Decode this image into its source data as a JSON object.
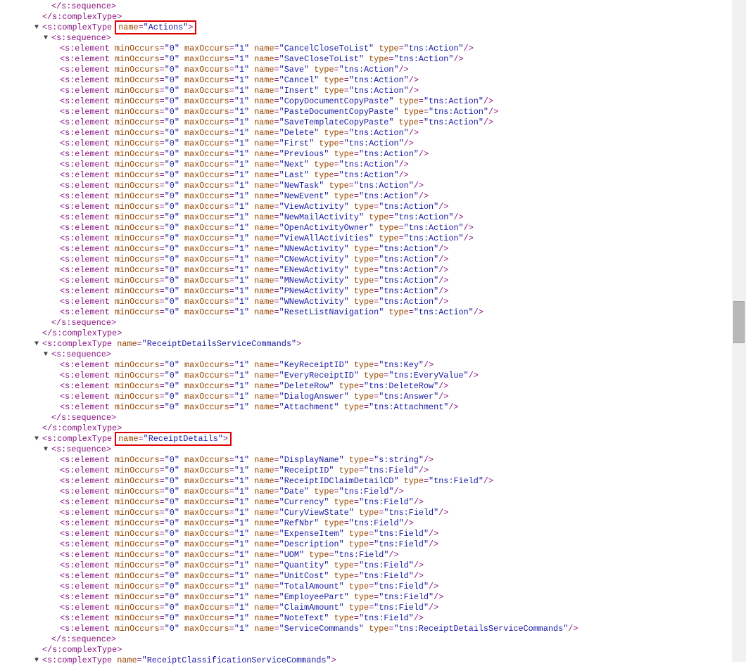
{
  "colors": {
    "tag": "#881280",
    "attr_name": "#994500",
    "attr_value": "#1a1aa6",
    "highlight": "#e00000"
  },
  "lines": [
    {
      "kind": "close",
      "tag": "s:sequence",
      "level": 1
    },
    {
      "kind": "close",
      "tag": "s:complexType",
      "level": 0
    },
    {
      "kind": "open",
      "tag": "s:complexType",
      "name": "Actions",
      "level": 0,
      "highlight": true
    },
    {
      "kind": "open",
      "tag": "s:sequence",
      "level": 1
    },
    {
      "kind": "el",
      "name": "CancelCloseToList",
      "type": "tns:Action"
    },
    {
      "kind": "el",
      "name": "SaveCloseToList",
      "type": "tns:Action"
    },
    {
      "kind": "el",
      "name": "Save",
      "type": "tns:Action"
    },
    {
      "kind": "el",
      "name": "Cancel",
      "type": "tns:Action"
    },
    {
      "kind": "el",
      "name": "Insert",
      "type": "tns:Action"
    },
    {
      "kind": "el",
      "name": "CopyDocumentCopyPaste",
      "type": "tns:Action"
    },
    {
      "kind": "el",
      "name": "PasteDocumentCopyPaste",
      "type": "tns:Action"
    },
    {
      "kind": "el",
      "name": "SaveTemplateCopyPaste",
      "type": "tns:Action"
    },
    {
      "kind": "el",
      "name": "Delete",
      "type": "tns:Action"
    },
    {
      "kind": "el",
      "name": "First",
      "type": "tns:Action"
    },
    {
      "kind": "el",
      "name": "Previous",
      "type": "tns:Action"
    },
    {
      "kind": "el",
      "name": "Next",
      "type": "tns:Action"
    },
    {
      "kind": "el",
      "name": "Last",
      "type": "tns:Action"
    },
    {
      "kind": "el",
      "name": "NewTask",
      "type": "tns:Action"
    },
    {
      "kind": "el",
      "name": "NewEvent",
      "type": "tns:Action"
    },
    {
      "kind": "el",
      "name": "ViewActivity",
      "type": "tns:Action"
    },
    {
      "kind": "el",
      "name": "NewMailActivity",
      "type": "tns:Action"
    },
    {
      "kind": "el",
      "name": "OpenActivityOwner",
      "type": "tns:Action"
    },
    {
      "kind": "el",
      "name": "ViewAllActivities",
      "type": "tns:Action"
    },
    {
      "kind": "el",
      "name": "NNewActivity",
      "type": "tns:Action"
    },
    {
      "kind": "el",
      "name": "CNewActivity",
      "type": "tns:Action"
    },
    {
      "kind": "el",
      "name": "ENewActivity",
      "type": "tns:Action"
    },
    {
      "kind": "el",
      "name": "MNewActivity",
      "type": "tns:Action"
    },
    {
      "kind": "el",
      "name": "PNewActivity",
      "type": "tns:Action"
    },
    {
      "kind": "el",
      "name": "WNewActivity",
      "type": "tns:Action"
    },
    {
      "kind": "el",
      "name": "ResetListNavigation",
      "type": "tns:Action"
    },
    {
      "kind": "close",
      "tag": "s:sequence",
      "level": 1
    },
    {
      "kind": "close",
      "tag": "s:complexType",
      "level": 0
    },
    {
      "kind": "open",
      "tag": "s:complexType",
      "name": "ReceiptDetailsServiceCommands",
      "level": 0
    },
    {
      "kind": "open",
      "tag": "s:sequence",
      "level": 1
    },
    {
      "kind": "el",
      "name": "KeyReceiptID",
      "type": "tns:Key"
    },
    {
      "kind": "el",
      "name": "EveryReceiptID",
      "type": "tns:EveryValue"
    },
    {
      "kind": "el",
      "name": "DeleteRow",
      "type": "tns:DeleteRow"
    },
    {
      "kind": "el",
      "name": "DialogAnswer",
      "type": "tns:Answer"
    },
    {
      "kind": "el",
      "name": "Attachment",
      "type": "tns:Attachment"
    },
    {
      "kind": "close",
      "tag": "s:sequence",
      "level": 1
    },
    {
      "kind": "close",
      "tag": "s:complexType",
      "level": 0
    },
    {
      "kind": "open",
      "tag": "s:complexType",
      "name": "ReceiptDetails",
      "level": 0,
      "highlight": true
    },
    {
      "kind": "open",
      "tag": "s:sequence",
      "level": 1
    },
    {
      "kind": "el",
      "name": "DisplayName",
      "type": "s:string"
    },
    {
      "kind": "el",
      "name": "ReceiptID",
      "type": "tns:Field"
    },
    {
      "kind": "el",
      "name": "ReceiptIDClaimDetailCD",
      "type": "tns:Field"
    },
    {
      "kind": "el",
      "name": "Date",
      "type": "tns:Field"
    },
    {
      "kind": "el",
      "name": "Currency",
      "type": "tns:Field"
    },
    {
      "kind": "el",
      "name": "CuryViewState",
      "type": "tns:Field"
    },
    {
      "kind": "el",
      "name": "RefNbr",
      "type": "tns:Field"
    },
    {
      "kind": "el",
      "name": "ExpenseItem",
      "type": "tns:Field"
    },
    {
      "kind": "el",
      "name": "Description",
      "type": "tns:Field"
    },
    {
      "kind": "el",
      "name": "UOM",
      "type": "tns:Field"
    },
    {
      "kind": "el",
      "name": "Quantity",
      "type": "tns:Field"
    },
    {
      "kind": "el",
      "name": "UnitCost",
      "type": "tns:Field"
    },
    {
      "kind": "el",
      "name": "TotalAmount",
      "type": "tns:Field"
    },
    {
      "kind": "el",
      "name": "EmployeePart",
      "type": "tns:Field"
    },
    {
      "kind": "el",
      "name": "ClaimAmount",
      "type": "tns:Field"
    },
    {
      "kind": "el",
      "name": "NoteText",
      "type": "tns:Field"
    },
    {
      "kind": "el",
      "name": "ServiceCommands",
      "type": "tns:ReceiptDetailsServiceCommands"
    },
    {
      "kind": "close",
      "tag": "s:sequence",
      "level": 1
    },
    {
      "kind": "close",
      "tag": "s:complexType",
      "level": 0
    },
    {
      "kind": "open",
      "tag": "s:complexType",
      "name": "ReceiptClassificationServiceCommands",
      "level": 0
    }
  ],
  "element_attrs": {
    "minOccurs": "0",
    "maxOccurs": "1"
  }
}
